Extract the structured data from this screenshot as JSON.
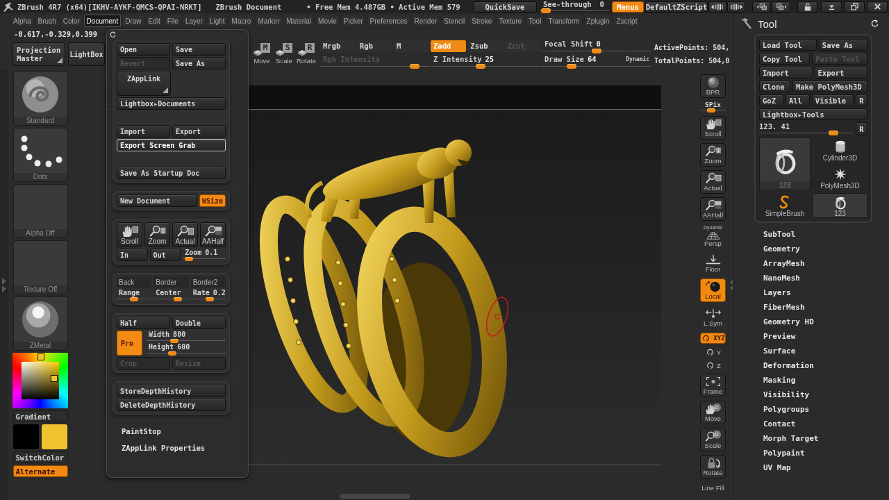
{
  "title_bar": {
    "title": "ZBrush 4R7 (x64)[IKHV-AYKF-QMCS-QPAI-NRKT]",
    "document": "ZBrush Document",
    "memory": "• Free Mem 4.487GB • Active Mem 579",
    "quicksave": "QuickSave",
    "see_through": {
      "label": "See-through",
      "value": "0",
      "level": 0.02
    },
    "menus": {
      "label": "Menus",
      "on": true
    },
    "zscript": "DefaultZScript"
  },
  "menu_bar": [
    {
      "label": "Alpha",
      "selected": false
    },
    {
      "label": "Brush",
      "selected": false
    },
    {
      "label": "Color",
      "selected": false
    },
    {
      "label": "Document",
      "selected": true
    },
    {
      "label": "Draw",
      "selected": false
    },
    {
      "label": "Edit",
      "selected": false
    },
    {
      "label": "File",
      "selected": false
    },
    {
      "label": "Layer",
      "selected": false
    },
    {
      "label": "Light",
      "selected": false
    },
    {
      "label": "Macro",
      "selected": false
    },
    {
      "label": "Marker",
      "selected": false
    },
    {
      "label": "Material",
      "selected": false
    },
    {
      "label": "Movie",
      "selected": false
    },
    {
      "label": "Picker",
      "selected": false
    },
    {
      "label": "Preferences",
      "selected": false
    },
    {
      "label": "Render",
      "selected": false
    },
    {
      "label": "Stencil",
      "selected": false
    },
    {
      "label": "Stroke",
      "selected": false
    },
    {
      "label": "Texture",
      "selected": false
    },
    {
      "label": "Tool",
      "selected": false
    },
    {
      "label": "Transform",
      "selected": false
    },
    {
      "label": "Zplugin",
      "selected": false
    },
    {
      "label": "Zscript",
      "selected": false
    }
  ],
  "coordinates": "-0.617,-0.329,0.399",
  "top_shelf": {
    "projection_master": "Projection Master",
    "lightbox": "LightBox",
    "transform": [
      {
        "key": "M",
        "label": "Move"
      },
      {
        "key": "S",
        "label": "Scale"
      },
      {
        "key": "R",
        "label": "Rotate"
      }
    ],
    "color_modes": [
      {
        "label": "Mrgb",
        "on": false
      },
      {
        "label": "Rgb",
        "on": false
      },
      {
        "label": "M",
        "on": false
      }
    ],
    "z_modes": [
      {
        "label": "Zadd",
        "on": true,
        "disabled": false
      },
      {
        "label": "Zsub",
        "on": false,
        "disabled": false
      },
      {
        "label": "Zcut",
        "on": false,
        "disabled": true
      }
    ],
    "rgb_intensity": {
      "label": "Rgb Intensity",
      "level": 0.9,
      "disabled": true
    },
    "z_intensity": {
      "label": "Z Intensity",
      "value": "25",
      "level": 0.45,
      "disabled": false
    },
    "focal_shift": {
      "label": "Focal Shift",
      "value": "0",
      "level": 0.5,
      "disabled": false
    },
    "draw_size": {
      "label": "Draw Size",
      "value": "64",
      "level": 0.25,
      "disabled": false
    },
    "dynamic": "Dynamic",
    "points": [
      "ActivePoints: 504,",
      "TotalPoints: 504,0"
    ]
  },
  "left_shelf": {
    "thumbnails": [
      {
        "kind": "brush",
        "label": "Standard"
      },
      {
        "kind": "dots",
        "label": "Dots"
      },
      {
        "kind": "empty",
        "label": "Alpha Off"
      },
      {
        "kind": "empty",
        "label": "Texture Off"
      },
      {
        "kind": "material",
        "label": "ZMetal"
      }
    ],
    "gradient": "Gradient",
    "swatches": [
      {
        "color": "#000000"
      },
      {
        "color": "#f0c22e"
      }
    ],
    "switch_color": "SwitchColor",
    "alternate": {
      "label": "Alternate",
      "on": true
    }
  },
  "right_shelf": [
    {
      "kind": "bpr",
      "label": "BPR",
      "on": false
    },
    {
      "kind": "slider",
      "label": "SPix",
      "level": 0.4
    },
    {
      "kind": "hand",
      "label": "Scroll",
      "on": false
    },
    {
      "kind": "zoom",
      "label": "Zoom",
      "on": false
    },
    {
      "kind": "actual",
      "label": "Actual",
      "on": false
    },
    {
      "kind": "aahalf",
      "label": "AAHalf",
      "on": false
    },
    {
      "kind": "persp",
      "label": "Persp",
      "note": "Dynamic",
      "on": false
    },
    {
      "kind": "floor",
      "label": "Floor",
      "on": false
    },
    {
      "kind": "local",
      "label": "Local",
      "on": true
    },
    {
      "kind": "lsym",
      "label": "L.Sym",
      "on": false
    },
    {
      "kind": "xyz",
      "label": "XYZ",
      "on": true
    },
    {
      "kind": "axis",
      "label": "Y",
      "on": false
    },
    {
      "kind": "axis",
      "label": "Z",
      "on": false
    },
    {
      "kind": "frame",
      "label": "Frame",
      "on": false
    },
    {
      "kind": "move",
      "label": "Move",
      "on": false
    },
    {
      "kind": "scale",
      "label": "Scale",
      "on": false
    },
    {
      "kind": "rotate",
      "label": "Rotate",
      "on": false
    },
    {
      "kind": "linefill",
      "label": "Line Fill",
      "on": false
    }
  ],
  "document_menu": {
    "panels": [
      {
        "sections": [
          [
            [
              {
                "kind": "button",
                "label": "Open",
                "disabled": false,
                "highlighted": false
              },
              {
                "kind": "button",
                "label": "Save",
                "disabled": false,
                "highlighted": false
              }
            ],
            [
              {
                "kind": "button",
                "label": "Revert",
                "disabled": true,
                "highlighted": false
              },
              {
                "kind": "button",
                "label": "Save As",
                "disabled": false,
                "highlighted": false
              }
            ],
            [
              {
                "kind": "popup",
                "label": "ZAppLink"
              }
            ],
            [
              {
                "kind": "button",
                "label": "Lightbox▸Documents",
                "disabled": false,
                "highlighted": false
              }
            ]
          ],
          [
            [
              {
                "kind": "button",
                "label": "Import",
                "disabled": false,
                "highlighted": false
              },
              {
                "kind": "button",
                "label": "Export",
                "disabled": false,
                "highlighted": false
              }
            ],
            [
              {
                "kind": "button",
                "label": "Export Screen Grab",
                "disabled": false,
                "highlighted": true
              }
            ]
          ],
          [
            [
              {
                "kind": "button",
                "label": "Save As Startup Doc",
                "disabled": false,
                "highlighted": false
              }
            ]
          ]
        ]
      },
      {
        "sections": [
          [
            [
              {
                "kind": "button",
                "label": "New Document",
                "disabled": false,
                "highlighted": false
              },
              {
                "kind": "toggle",
                "label": "WSize",
                "on": true
              }
            ]
          ]
        ]
      },
      {
        "sections": [
          [
            [
              {
                "kind": "hand",
                "label": "Scroll"
              },
              {
                "kind": "zoom",
                "label": "Zoom"
              },
              {
                "kind": "actual",
                "label": "Actual"
              },
              {
                "kind": "aahalf",
                "label": "AAHalf"
              }
            ],
            [
              {
                "kind": "button",
                "label": "In",
                "disabled": false,
                "highlighted": false
              },
              {
                "kind": "button",
                "label": "Out",
                "disabled": false,
                "highlighted": false
              },
              {
                "kind": "slider",
                "label": "Zoom",
                "value": "0.1",
                "level": 0.06
              }
            ]
          ]
        ]
      },
      {
        "sections": [
          [
            [
              {
                "kind": "swatch",
                "label": "Back"
              },
              {
                "kind": "swatch",
                "label": "Border"
              },
              {
                "kind": "swatch",
                "label": "Border2"
              }
            ],
            [
              {
                "kind": "slider",
                "label": "Range",
                "level": 0.5
              },
              {
                "kind": "slider",
                "label": "Center",
                "level": 0.75
              },
              {
                "kind": "slider",
                "label": "Rate",
                "value": "0.2",
                "level": 0.55
              }
            ]
          ]
        ]
      },
      {
        "sections": [
          [
            [
              {
                "kind": "button",
                "label": "Half",
                "disabled": false,
                "highlighted": false
              },
              {
                "kind": "button",
                "label": "Double",
                "disabled": false,
                "highlighted": false
              }
            ],
            [
              {
                "kind": "pro",
                "label": "Pro",
                "on": true,
                "sliders": [
                  {
                    "label": "Width",
                    "value": "800",
                    "level": 0.33
                  },
                  {
                    "label": "Height",
                    "value": "600",
                    "level": 0.3
                  }
                ]
              }
            ],
            [
              {
                "kind": "button",
                "label": "Crop",
                "disabled": true,
                "highlighted": false
              },
              {
                "kind": "button",
                "label": "Resize",
                "disabled": true,
                "highlighted": false
              }
            ]
          ]
        ]
      },
      {
        "sections": [
          [
            [
              {
                "kind": "button",
                "label": "StoreDepthHistory",
                "disabled": false,
                "highlighted": false
              }
            ],
            [
              {
                "kind": "button",
                "label": "DeleteDepthHistory",
                "disabled": false,
                "highlighted": false
              }
            ]
          ]
        ]
      }
    ],
    "items": [
      "PaintStop",
      "ZAppLink Properties"
    ]
  },
  "tool_palette": {
    "title": "Tool",
    "rows": [
      [
        {
          "kind": "button",
          "label": "Load Tool",
          "disabled": false
        },
        {
          "kind": "button",
          "label": "Save As",
          "disabled": false
        }
      ],
      [
        {
          "kind": "button",
          "label": "Copy Tool",
          "disabled": false
        },
        {
          "kind": "button",
          "label": "Paste Tool",
          "disabled": true
        }
      ],
      [
        {
          "kind": "button",
          "label": "Import",
          "disabled": false
        },
        {
          "kind": "button",
          "label": "Export",
          "disabled": false
        }
      ],
      [
        {
          "kind": "button",
          "label": "Clone",
          "disabled": false
        },
        {
          "kind": "button",
          "label": "Make PolyMesh3D",
          "disabled": false
        }
      ],
      [
        {
          "kind": "button",
          "label": "GoZ",
          "disabled": false
        },
        {
          "kind": "button",
          "label": "All",
          "disabled": false
        },
        {
          "kind": "button",
          "label": "Visible",
          "disabled": false
        },
        {
          "kind": "small",
          "label": "R",
          "disabled": false
        }
      ],
      [
        {
          "kind": "button",
          "label": "Lightbox▸Tools",
          "disabled": false
        }
      ]
    ],
    "slider": {
      "value": "123. 41",
      "level": 0.83,
      "reset": "R"
    },
    "current_tool": {
      "label": "123"
    },
    "tools": [
      {
        "kind": "cylinder",
        "label": "Cylinder3D",
        "selected": false
      },
      {
        "kind": "star",
        "label": "PolyMesh3D",
        "selected": false
      },
      {
        "kind": "brush",
        "label": "SimpleBrush",
        "selected": false
      },
      {
        "kind": "ring",
        "label": "123",
        "selected": true
      }
    ]
  },
  "subpalettes": [
    "SubTool",
    "Geometry",
    "ArrayMesh",
    "NanoMesh",
    "Layers",
    "FiberMesh",
    "Geometry HD",
    "Preview",
    "Surface",
    "Deformation",
    "Masking",
    "Visibility",
    "Polygroups",
    "Contact",
    "Morph Target",
    "Polypaint",
    "UV Map"
  ]
}
